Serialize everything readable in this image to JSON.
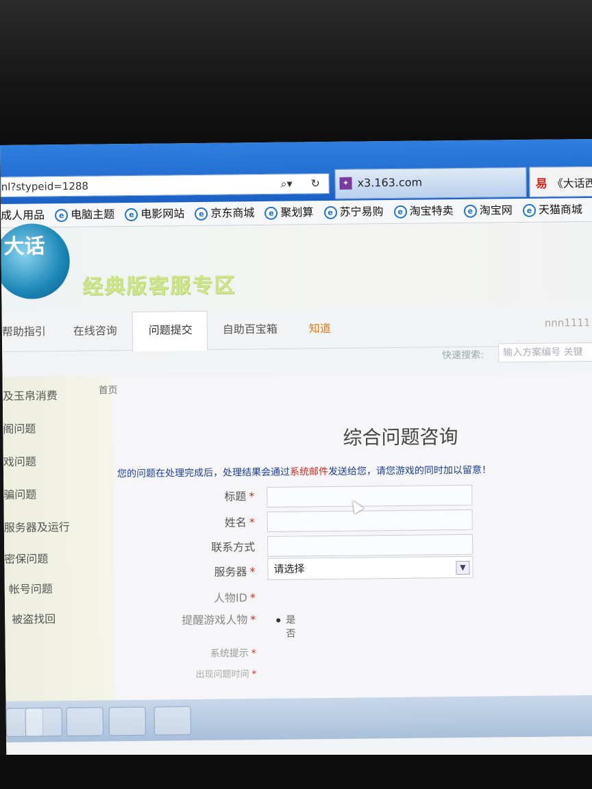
{
  "browser": {
    "address_url": "nl?stypeid=1288",
    "tabs": [
      {
        "label": "x3.163.com"
      },
      {
        "label": "《大话西"
      }
    ],
    "favorites": [
      "成人用品",
      "电脑主题",
      "电影网站",
      "京东商城",
      "聚划算",
      "苏宁易购",
      "淘宝特卖",
      "淘宝网",
      "天猫商城"
    ]
  },
  "banner": {
    "logo_text": "大话",
    "title": "经典版客服专区"
  },
  "nav": {
    "items": [
      "帮助指引",
      "在线咨询",
      "问题提交",
      "自助百宝箱",
      "知道"
    ],
    "active": "问题提交",
    "user": "nnn1111"
  },
  "search": {
    "label": "快速搜索:",
    "placeholder": "输入方案编号 关键"
  },
  "sidebar": {
    "items": [
      "及玉帛消费",
      "阁问题",
      "戏问题",
      "骗问题",
      "服务器及运行",
      "密保问题",
      "帐号问题",
      "被盗找回"
    ]
  },
  "breadcrumb": "首页",
  "form": {
    "title": "综合问题咨询",
    "notice_prefix": "您的问题在处理完成后，处理结果会通过",
    "notice_highlight": "系统邮件",
    "notice_suffix": "发送给您，请您游戏的同时加以留意！",
    "fields": {
      "title_label": "标题",
      "name_label": "姓名",
      "contact_label": "联系方式",
      "server_label": "服务器",
      "server_value": "请选择",
      "role_label": "人物ID",
      "remind_label": "提醒游戏人物",
      "remind_yes": "是",
      "remind_no": "否",
      "system_tip_label": "系统提示",
      "time_label": "出现问题时间"
    },
    "required_mark": "*"
  },
  "colors": {
    "chrome_blue": "#1a5fc4",
    "notice_blue": "#1d3f9a",
    "highlight_red": "#d42a1f",
    "banner_green": "#cfe58a"
  }
}
